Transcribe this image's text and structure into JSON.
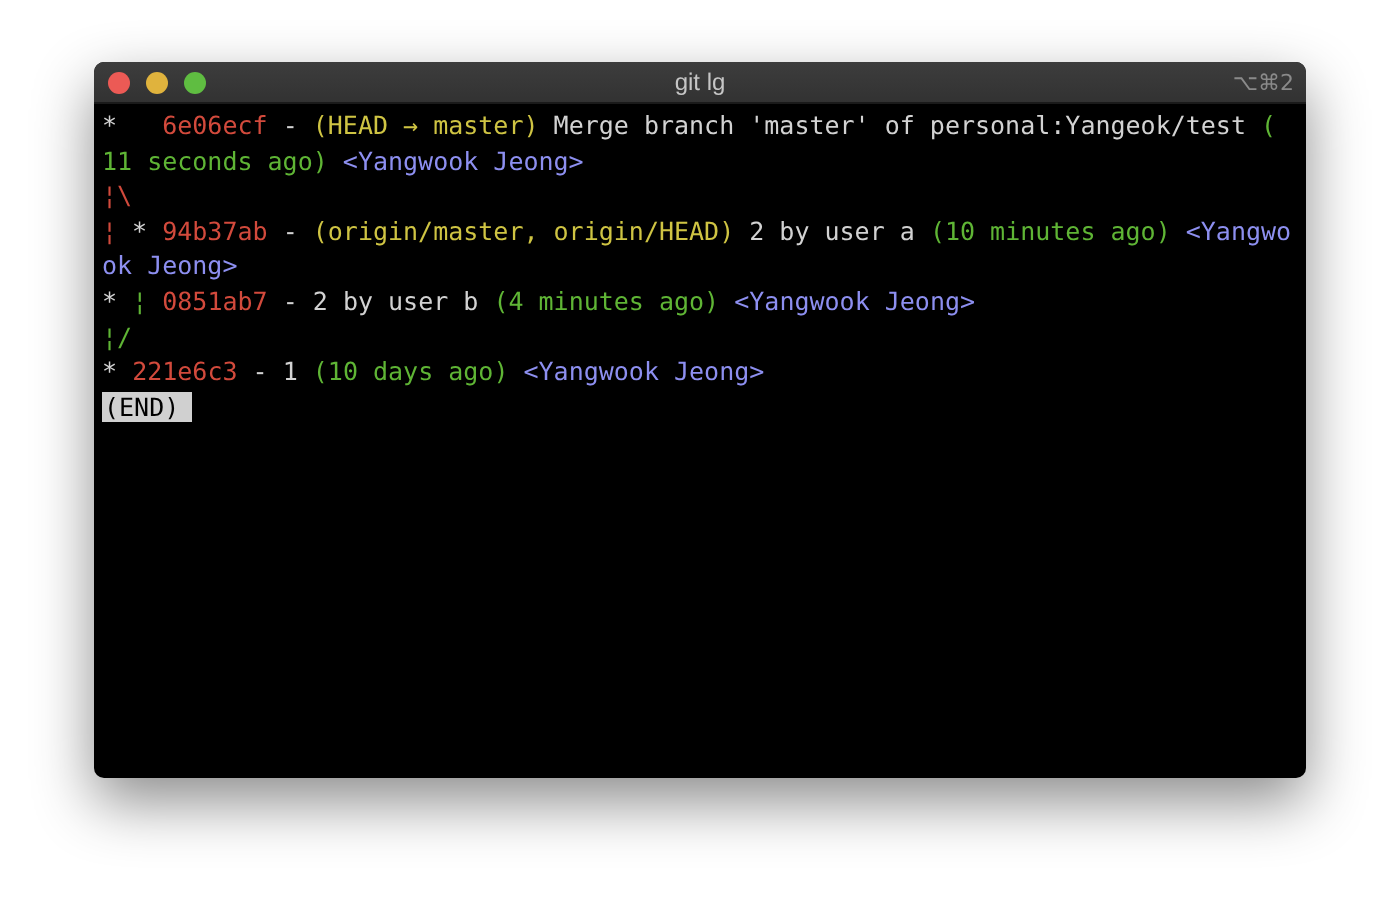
{
  "window": {
    "title": "git lg",
    "shortcut": "⌥⌘2"
  },
  "lines": [
    {
      "segments": [
        {
          "kind": "graph",
          "text": "*   "
        },
        {
          "kind": "hash",
          "text": "6e06ecf"
        },
        {
          "kind": "plain",
          "text": " - "
        },
        {
          "kind": "refs",
          "text": "(HEAD → master)"
        },
        {
          "kind": "plain",
          "text": " Merge branch 'master' of personal:Yangeok/test "
        },
        {
          "kind": "date",
          "text": "("
        }
      ]
    },
    {
      "segments": [
        {
          "kind": "date",
          "text": "11 seconds ago) "
        },
        {
          "kind": "author",
          "text": "<Yangwook Jeong>"
        }
      ]
    },
    {
      "segments": [
        {
          "kind": "graph-red",
          "text": "¦\\"
        }
      ]
    },
    {
      "segments": [
        {
          "kind": "graph-red",
          "text": "¦"
        },
        {
          "kind": "graph",
          "text": " * "
        },
        {
          "kind": "hash",
          "text": "94b37ab"
        },
        {
          "kind": "plain",
          "text": " - "
        },
        {
          "kind": "refs",
          "text": "(origin/master, origin/HEAD)"
        },
        {
          "kind": "plain",
          "text": " 2 by user a "
        },
        {
          "kind": "date",
          "text": "(10 minutes ago) "
        },
        {
          "kind": "author",
          "text": "<Yangwo"
        }
      ]
    },
    {
      "segments": [
        {
          "kind": "author",
          "text": "ok Jeong>"
        }
      ]
    },
    {
      "segments": [
        {
          "kind": "graph",
          "text": "* "
        },
        {
          "kind": "graph-green",
          "text": "¦ "
        },
        {
          "kind": "hash",
          "text": "0851ab7"
        },
        {
          "kind": "plain",
          "text": " - 2 by user b "
        },
        {
          "kind": "date",
          "text": "(4 minutes ago) "
        },
        {
          "kind": "author",
          "text": "<Yangwook Jeong>"
        }
      ]
    },
    {
      "segments": [
        {
          "kind": "graph-green",
          "text": "¦/"
        }
      ]
    },
    {
      "segments": [
        {
          "kind": "graph",
          "text": "* "
        },
        {
          "kind": "hash",
          "text": "221e6c3"
        },
        {
          "kind": "plain",
          "text": " - 1 "
        },
        {
          "kind": "date",
          "text": "(10 days ago) "
        },
        {
          "kind": "author",
          "text": "<Yangwook Jeong>"
        }
      ]
    }
  ],
  "pager_prompt": "(END)"
}
